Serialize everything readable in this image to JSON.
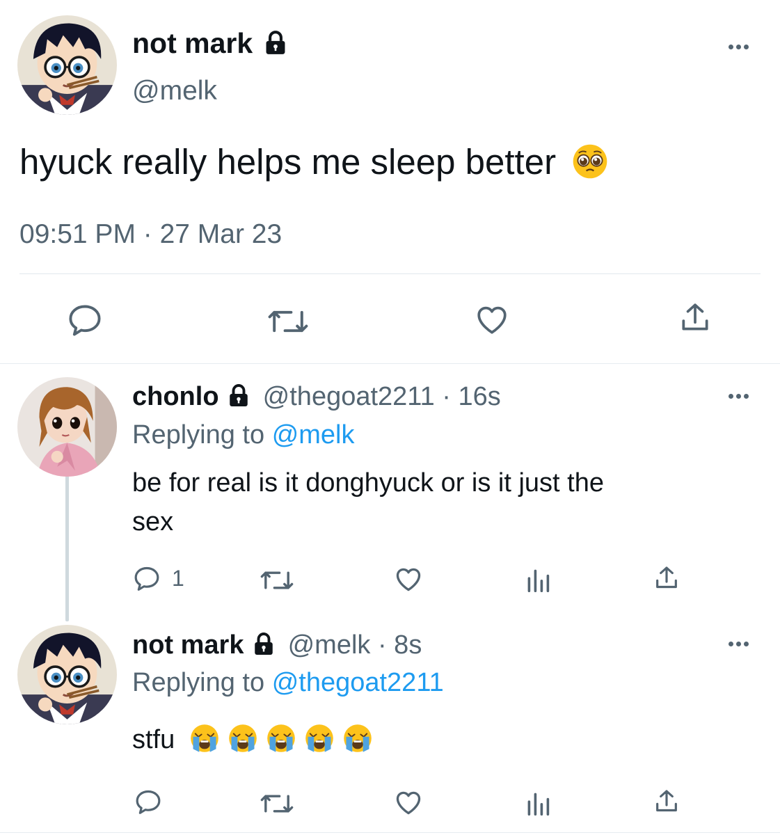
{
  "main_tweet": {
    "display_name": "not mark",
    "handle": "@melk",
    "text": "hyuck really helps me sleep better",
    "emoji": "pleading-face",
    "timestamp": "09:51 PM · 27 Mar 23",
    "locked": true
  },
  "action_icons": [
    "reply-icon",
    "retweet-icon",
    "like-icon",
    "share-icon"
  ],
  "replies": [
    {
      "display_name": "chonlo",
      "handle_time": "@thegoat2211 · 16s",
      "replying_label": "Replying to",
      "replying_to": "@melk",
      "text_line1": "be for real is it donghyuck or is it just the",
      "text_line2": "sex",
      "reply_count": "1",
      "locked": true
    },
    {
      "display_name": "not mark",
      "handle_time": "@melk · 8s",
      "replying_label": "Replying to",
      "replying_to": "@thegoat2211",
      "text": "stfu",
      "emoji": "loudly-crying-face",
      "emoji_count": 5,
      "locked": true
    }
  ],
  "colors": {
    "text": "#0f1419",
    "secondary": "#536471",
    "link": "#1d9bf0",
    "divider": "#e1e8ed"
  }
}
